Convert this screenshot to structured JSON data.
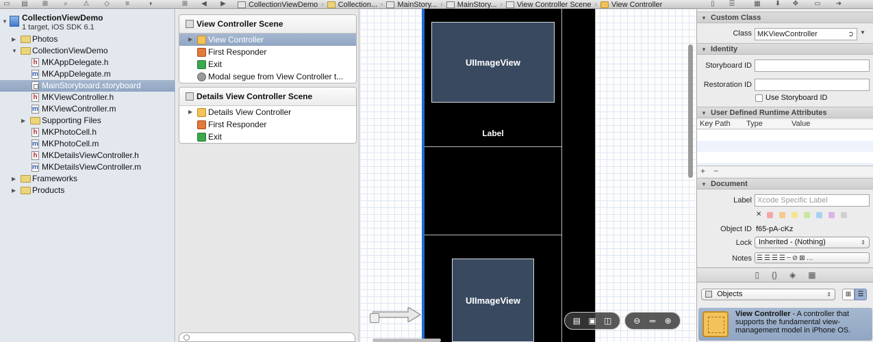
{
  "jumpbar": {
    "items": [
      "CollectionViewDemo",
      "Collection...",
      "MainStory...",
      "MainStory...",
      "View Controller Scene",
      "View Controller"
    ]
  },
  "navigator": {
    "project_name": "CollectionViewDemo",
    "project_sub": "1 target, iOS SDK 6.1",
    "items": [
      {
        "label": "Photos",
        "kind": "folder"
      },
      {
        "label": "CollectionViewDemo",
        "kind": "folder"
      },
      {
        "label": "MKAppDelegate.h",
        "kind": "h"
      },
      {
        "label": "MKAppDelegate.m",
        "kind": "m"
      },
      {
        "label": "MainStoryboard.storyboard",
        "kind": "storyboard"
      },
      {
        "label": "MKViewController.h",
        "kind": "h"
      },
      {
        "label": "MKViewController.m",
        "kind": "m"
      },
      {
        "label": "Supporting Files",
        "kind": "folder"
      },
      {
        "label": "MKPhotoCell.h",
        "kind": "h"
      },
      {
        "label": "MKPhotoCell.m",
        "kind": "m"
      },
      {
        "label": "MKDetailsViewController.h",
        "kind": "h"
      },
      {
        "label": "MKDetailsViewController.m",
        "kind": "m"
      },
      {
        "label": "Frameworks",
        "kind": "folder"
      },
      {
        "label": "Products",
        "kind": "folder"
      }
    ]
  },
  "outline": {
    "scene1": {
      "title": "View Controller Scene",
      "items": [
        "View Controller",
        "First Responder",
        "Exit",
        "Modal segue from View Controller t..."
      ]
    },
    "scene2": {
      "title": "Details View Controller Scene",
      "items": [
        "Details View Controller",
        "First Responder",
        "Exit"
      ]
    }
  },
  "canvas": {
    "image_view_1": "UIImageView",
    "label": "Label",
    "image_view_2": "UIImageView"
  },
  "inspector": {
    "custom_class": {
      "header": "Custom Class",
      "class_label": "Class",
      "class_value": "MKViewController"
    },
    "identity": {
      "header": "Identity",
      "storyboard_id_label": "Storyboard ID",
      "storyboard_id_value": "",
      "restoration_id_label": "Restoration ID",
      "restoration_id_value": "",
      "use_storyboard_id": "Use Storyboard ID",
      "use_storyboard_id_checked": false
    },
    "runtime": {
      "header": "User Defined Runtime Attributes",
      "col_keypath": "Key Path",
      "col_type": "Type",
      "col_value": "Value",
      "add": "+",
      "remove": "−"
    },
    "document": {
      "header": "Document",
      "label_label": "Label",
      "label_placeholder": "Xcode Specific Label",
      "clear": "✕",
      "object_id_label": "Object ID",
      "object_id_value": "f65-pA-cKz",
      "lock_label": "Lock",
      "lock_value": "Inherited - (Nothing)",
      "notes_label": "Notes"
    },
    "library": {
      "selector": "Objects",
      "item_title": "View Controller",
      "item_desc": " - A controller that supports the fundamental view-management model in iPhone OS."
    }
  },
  "colors": {
    "selection": "#96abc7",
    "canvas_black": "#000000",
    "imageview_fill": "#394a60",
    "scene_edge": "#1e6fd9"
  }
}
